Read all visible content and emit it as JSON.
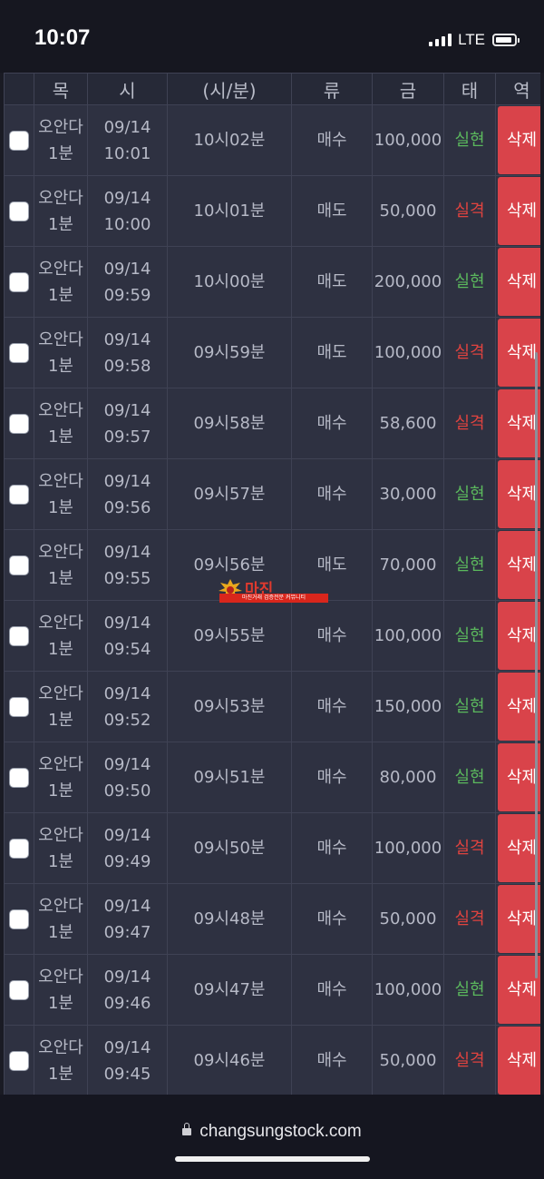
{
  "status_bar": {
    "time": "10:07",
    "network": "LTE"
  },
  "table": {
    "headers": [
      "",
      "목",
      "시",
      "(시/분)",
      "류",
      "금",
      "태",
      "역"
    ],
    "rows": [
      {
        "item": [
          "오안다",
          "1분"
        ],
        "time": [
          "09/14",
          "10:01"
        ],
        "hm": "10시02분",
        "type": "매수",
        "amount": "100,000",
        "result": "실현",
        "result_kind": "win"
      },
      {
        "item": [
          "오안다",
          "1분"
        ],
        "time": [
          "09/14",
          "10:00"
        ],
        "hm": "10시01분",
        "type": "매도",
        "amount": "50,000",
        "result": "실격",
        "result_kind": "loss"
      },
      {
        "item": [
          "오안다",
          "1분"
        ],
        "time": [
          "09/14",
          "09:59"
        ],
        "hm": "10시00분",
        "type": "매도",
        "amount": "200,000",
        "result": "실현",
        "result_kind": "win"
      },
      {
        "item": [
          "오안다",
          "1분"
        ],
        "time": [
          "09/14",
          "09:58"
        ],
        "hm": "09시59분",
        "type": "매도",
        "amount": "100,000",
        "result": "실격",
        "result_kind": "loss"
      },
      {
        "item": [
          "오안다",
          "1분"
        ],
        "time": [
          "09/14",
          "09:57"
        ],
        "hm": "09시58분",
        "type": "매수",
        "amount": "58,600",
        "result": "실격",
        "result_kind": "loss"
      },
      {
        "item": [
          "오안다",
          "1분"
        ],
        "time": [
          "09/14",
          "09:56"
        ],
        "hm": "09시57분",
        "type": "매수",
        "amount": "30,000",
        "result": "실현",
        "result_kind": "win"
      },
      {
        "item": [
          "오안다",
          "1분"
        ],
        "time": [
          "09/14",
          "09:55"
        ],
        "hm": "09시56분",
        "type": "매도",
        "amount": "70,000",
        "result": "실현",
        "result_kind": "win"
      },
      {
        "item": [
          "오안다",
          "1분"
        ],
        "time": [
          "09/14",
          "09:54"
        ],
        "hm": "09시55분",
        "type": "매수",
        "amount": "100,000",
        "result": "실현",
        "result_kind": "win"
      },
      {
        "item": [
          "오안다",
          "1분"
        ],
        "time": [
          "09/14",
          "09:52"
        ],
        "hm": "09시53분",
        "type": "매수",
        "amount": "150,000",
        "result": "실현",
        "result_kind": "win"
      },
      {
        "item": [
          "오안다",
          "1분"
        ],
        "time": [
          "09/14",
          "09:50"
        ],
        "hm": "09시51분",
        "type": "매수",
        "amount": "80,000",
        "result": "실현",
        "result_kind": "win"
      },
      {
        "item": [
          "오안다",
          "1분"
        ],
        "time": [
          "09/14",
          "09:49"
        ],
        "hm": "09시50분",
        "type": "매수",
        "amount": "100,000",
        "result": "실격",
        "result_kind": "loss"
      },
      {
        "item": [
          "오안다",
          "1분"
        ],
        "time": [
          "09/14",
          "09:47"
        ],
        "hm": "09시48분",
        "type": "매수",
        "amount": "50,000",
        "result": "실격",
        "result_kind": "loss"
      },
      {
        "item": [
          "오안다",
          "1분"
        ],
        "time": [
          "09/14",
          "09:46"
        ],
        "hm": "09시47분",
        "type": "매수",
        "amount": "100,000",
        "result": "실현",
        "result_kind": "win"
      },
      {
        "item": [
          "오안다",
          "1분"
        ],
        "time": [
          "09/14",
          "09:45"
        ],
        "hm": "09시46분",
        "type": "매수",
        "amount": "50,000",
        "result": "실격",
        "result_kind": "loss"
      }
    ],
    "delete_label": [
      "삭",
      "제"
    ]
  },
  "watermark": {
    "title": "마진",
    "subtitle": "마진거래 검증전문 커뮤니티"
  },
  "browser": {
    "url": "changsungstock.com"
  },
  "colors": {
    "win": "#5bb85d",
    "loss": "#e0433f",
    "delete": "#d9434a"
  }
}
